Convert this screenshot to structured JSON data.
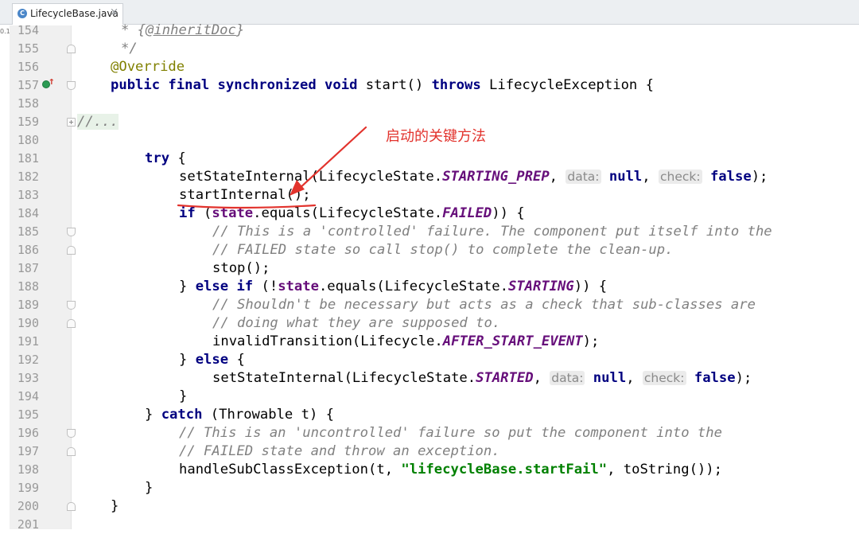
{
  "tab": {
    "filename": "LifecycleBase.java",
    "icon": "class-file-icon",
    "close_glyph": "×"
  },
  "left_strip": {
    "stub_text": "0.1"
  },
  "gutter": {
    "line_numbers": [
      "154",
      "155",
      "156",
      "157",
      "158",
      "159",
      "180",
      "181",
      "182",
      "183",
      "184",
      "185",
      "186",
      "187",
      "188",
      "189",
      "190",
      "191",
      "192",
      "193",
      "194",
      "195",
      "196",
      "197",
      "198",
      "199",
      "200",
      "201"
    ]
  },
  "code": {
    "l154": {
      "t1": "* {",
      "t2": "@inheritDoc",
      "t3": "}"
    },
    "l155": {
      "t1": "*/"
    },
    "l156": {
      "annotation": "@Override"
    },
    "l157": {
      "kw": "public final synchronized void",
      "t1": " start() ",
      "kw2": "throws",
      "t2": " LifecycleException {"
    },
    "l159": {
      "folded": "//..."
    },
    "l181": {
      "kw": "try",
      "t1": " {"
    },
    "l182": {
      "t1": "setStateInternal(LifecycleState.",
      "const": "STARTING_PREP",
      "t2": ", ",
      "hint1": "data:",
      "kw1": "null",
      "t3": ", ",
      "hint2": "check:",
      "kw2": "false",
      "t4": ");"
    },
    "l183": {
      "t1": "startInternal();"
    },
    "l184": {
      "kw": "if",
      "t1": " (",
      "fld": "state",
      "t2": ".equals(LifecycleState.",
      "const": "FAILED",
      "t3": ")) {"
    },
    "l185": {
      "cmt": "// This is a 'controlled' failure. The component put itself into the"
    },
    "l186": {
      "cmt": "// FAILED state so call stop() to complete the clean-up."
    },
    "l187": {
      "t1": "stop();"
    },
    "l188": {
      "t1": "} ",
      "kw": "else if",
      "t2": " (!",
      "fld": "state",
      "t3": ".equals(LifecycleState.",
      "const": "STARTING",
      "t4": ")) {"
    },
    "l189": {
      "cmt": "// Shouldn't be necessary but acts as a check that sub-classes are"
    },
    "l190": {
      "cmt": "// doing what they are supposed to."
    },
    "l191": {
      "t1": "invalidTransition(Lifecycle.",
      "const": "AFTER_START_EVENT",
      "t2": ");"
    },
    "l192": {
      "t1": "} ",
      "kw": "else",
      "t2": " {"
    },
    "l193": {
      "t1": "setStateInternal(LifecycleState.",
      "const": "STARTED",
      "t2": ", ",
      "hint1": "data:",
      "kw1": "null",
      "t3": ", ",
      "hint2": "check:",
      "kw2": "false",
      "t4": ");"
    },
    "l194": {
      "t1": "}"
    },
    "l195": {
      "t1": "} ",
      "kw": "catch",
      "t2": " (Throwable t) {"
    },
    "l196": {
      "cmt": "// This is an 'uncontrolled' failure so put the component into the"
    },
    "l197": {
      "cmt": "// FAILED state and throw an exception."
    },
    "l198": {
      "t1": "handleSubClassException(t, ",
      "str": "\"lifecycleBase.startFail\"",
      "t2": ", toString());"
    },
    "l199": {
      "t1": "}"
    },
    "l200": {
      "t1": "}"
    }
  },
  "annotation": {
    "text": "启动的关键方法",
    "color": "#e2332d"
  },
  "colors": {
    "keyword": "#000080",
    "annotation": "#808000",
    "comment": "#808080",
    "constant": "#660e7a",
    "string": "#008000",
    "gutter_bg": "#f0f0f0",
    "line_number": "#999999"
  }
}
